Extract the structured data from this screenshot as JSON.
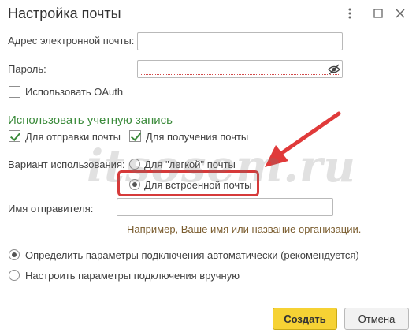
{
  "window": {
    "title": "Настройка почты",
    "icons": [
      "menu-icon",
      "maximize-icon",
      "close-icon"
    ]
  },
  "form": {
    "email_label": "Адрес электронной почты:",
    "email_value": "",
    "password_label": "Пароль:",
    "password_value": "",
    "oauth_label": "Использовать OAuth",
    "oauth_checked": false
  },
  "account": {
    "section_title": "Использовать учетную запись",
    "send_label": "Для отправки почты",
    "send_checked": true,
    "receive_label": "Для получения почты",
    "receive_checked": true
  },
  "usage": {
    "label": "Вариант использования:",
    "option_light": "Для \"легкой\" почты",
    "option_builtin": "Для встроенной почты",
    "selected": "builtin"
  },
  "sender": {
    "label": "Имя отправителя:",
    "value": "",
    "hint": "Например, Ваше имя или название организации."
  },
  "connection": {
    "auto_label": "Определить параметры подключения автоматически (рекомендуется)",
    "manual_label": "Настроить параметры подключения вручную",
    "selected": "auto"
  },
  "buttons": {
    "create_label": "Создать",
    "cancel_label": "Отмена"
  },
  "watermark": "itsosem.ru",
  "colors": {
    "section_green": "#3a8a3a",
    "primary_button": "#f6d234",
    "highlight_red": "#d63a3a",
    "hint_brown": "#7a5c2e"
  }
}
